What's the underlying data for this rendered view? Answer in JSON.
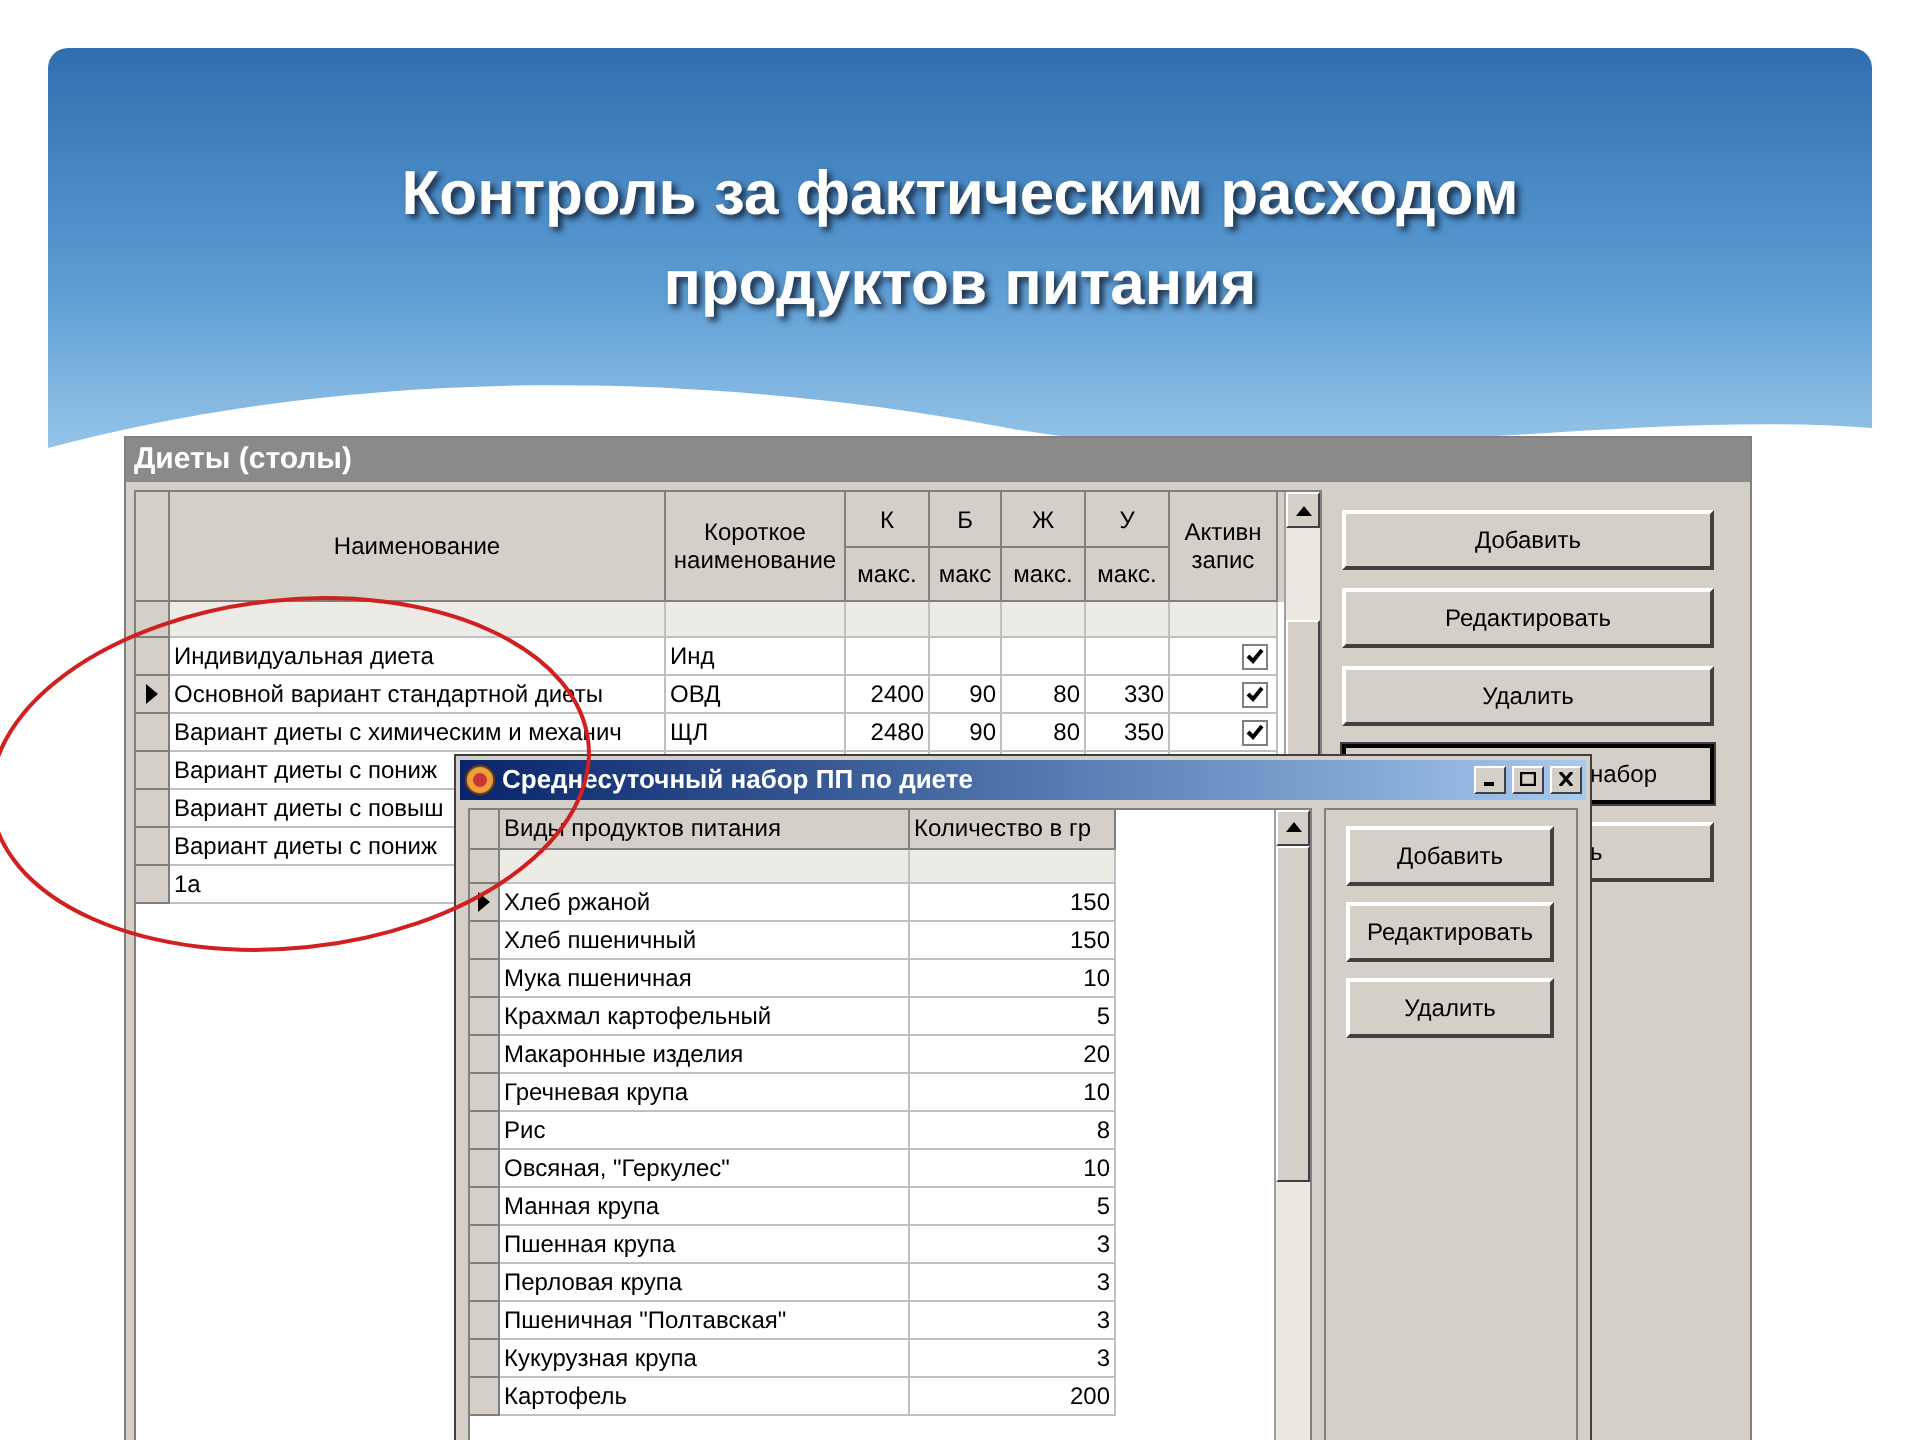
{
  "slide": {
    "title": "Контроль за фактическим расходом продуктов питания"
  },
  "diets_window": {
    "title": "Диеты (столы)",
    "columns": {
      "name": "Наименование",
      "short": "Короткое наименование",
      "k": "К",
      "k_sub": "макс.",
      "b": "Б",
      "b_sub": "макс",
      "zh": "Ж",
      "zh_sub": "макс.",
      "u": "У",
      "u_sub": "макс.",
      "active": "Активн запис"
    },
    "rows": [
      {
        "name": "Индивидуальная диета",
        "short": "Инд",
        "active": true,
        "selected": false
      },
      {
        "name": "Основной вариант стандартной диеты",
        "short": "ОВД",
        "k": "2400",
        "b": "90",
        "zh": "80",
        "u": "330",
        "active": true,
        "selected": true
      },
      {
        "name": "Вариант диеты с химическим и механич",
        "short": "ЩЛ",
        "k": "2480",
        "b": "90",
        "zh": "80",
        "u": "350",
        "active": true,
        "selected": false
      },
      {
        "name": "Вариант диеты с пониж",
        "selected": false
      },
      {
        "name": "Вариант диеты с повыш",
        "selected": false
      },
      {
        "name": "Вариант диеты с пониж",
        "selected": false
      },
      {
        "name": "1а",
        "selected": false
      }
    ],
    "buttons": [
      {
        "label": "Добавить",
        "kind": "normal"
      },
      {
        "label": "Редактировать",
        "kind": "normal"
      },
      {
        "label": "Удалить",
        "kind": "normal"
      },
      {
        "label": "набор",
        "kind": "covered_default"
      },
      {
        "label": "ь",
        "kind": "covered"
      }
    ]
  },
  "dialog": {
    "title": "Среднесуточный набор ПП по диете",
    "columns": {
      "name": "Виды продуктов питания",
      "qty": "Количество в гр"
    },
    "rows": [
      {
        "name": "Хлеб ржаной",
        "qty": "150",
        "selected": true
      },
      {
        "name": "Хлеб пшеничный",
        "qty": "150",
        "selected": false
      },
      {
        "name": "Мука пшеничная",
        "qty": "10",
        "selected": false
      },
      {
        "name": "Крахмал картофельный",
        "qty": "5",
        "selected": false
      },
      {
        "name": "Макаронные изделия",
        "qty": "20",
        "selected": false
      },
      {
        "name": "Гречневая крупа",
        "qty": "10",
        "selected": false
      },
      {
        "name": "Рис",
        "qty": "8",
        "selected": false
      },
      {
        "name": "Овсяная, \"Геркулес\"",
        "qty": "10",
        "selected": false
      },
      {
        "name": "Манная крупа",
        "qty": "5",
        "selected": false
      },
      {
        "name": "Пшенная крупа",
        "qty": "3",
        "selected": false
      },
      {
        "name": "Перловая крупа",
        "qty": "3",
        "selected": false
      },
      {
        "name": "Пшеничная \"Полтавская\"",
        "qty": "3",
        "selected": false
      },
      {
        "name": "Кукурузная крупа",
        "qty": "3",
        "selected": false
      },
      {
        "name": "Картофель",
        "qty": "200",
        "selected": false
      }
    ],
    "buttons": [
      "Добавить",
      "Редактировать",
      "Удалить"
    ]
  }
}
